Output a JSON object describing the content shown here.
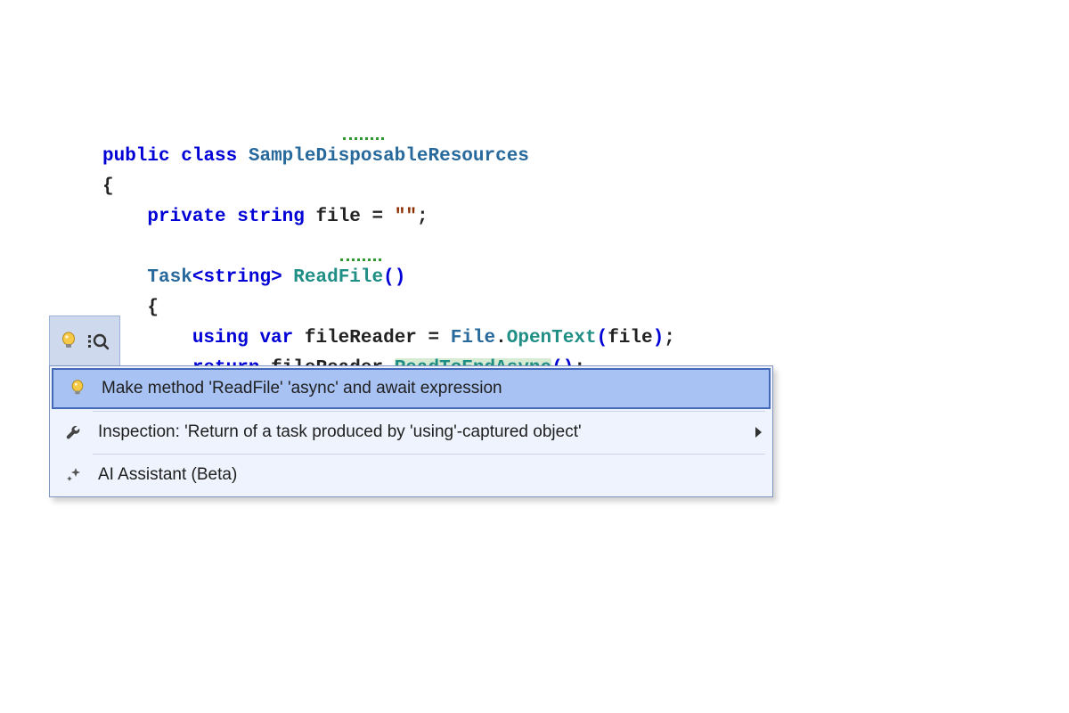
{
  "code": {
    "kw_public": "public",
    "kw_class": "class",
    "class_name": "SampleDisposableResources",
    "brace_open": "{",
    "kw_private": "private",
    "kw_string": "string",
    "field_name": "file",
    "eq": " = ",
    "empty_str": "\"\"",
    "semi": ";",
    "task": "Task",
    "lt": "<",
    "gt": ">",
    "method_name": "ReadFile",
    "parens": "()",
    "brace_open2": "{",
    "kw_using": "using",
    "kw_var": "var",
    "var_reader": "fileReader",
    "eq2": " = ",
    "file_cls": "File",
    "dot": ".",
    "open_text": "OpenText",
    "lp": "(",
    "arg_file": "file",
    "rp": ")",
    "kw_return": "return",
    "reader2": "fileReader",
    "read_async": "ReadToEndAsync",
    "parens2": "()"
  },
  "popup": {
    "items": [
      {
        "label": "Make method 'ReadFile' 'async' and await expression",
        "icon": "bulb",
        "selected": true,
        "submenu": false
      },
      {
        "label": "Inspection: 'Return of a task produced by 'using'-captured object'",
        "icon": "wrench",
        "selected": false,
        "submenu": true
      },
      {
        "label": "AI Assistant (Beta)",
        "icon": "sparkle",
        "selected": false,
        "submenu": false
      }
    ]
  }
}
